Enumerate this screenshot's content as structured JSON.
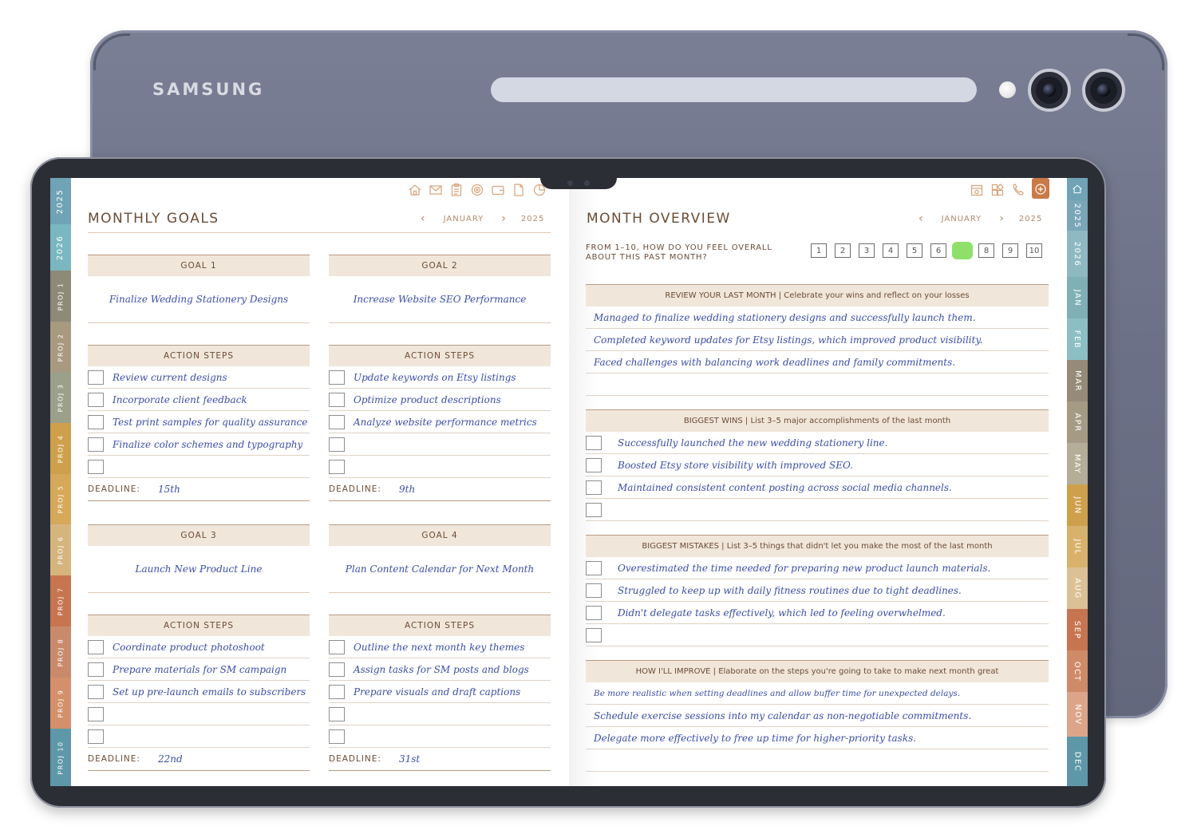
{
  "device": {
    "brand": "SAMSUNG"
  },
  "left_tabs": [
    {
      "label": "2025",
      "color": "#6fa3b5"
    },
    {
      "label": "2026",
      "color": "#7ab7c0"
    },
    {
      "label": "PROJ 1",
      "color": "#8d8a78"
    },
    {
      "label": "PROJ 2",
      "color": "#a79a7f"
    },
    {
      "label": "PROJ 3",
      "color": "#9aa08a"
    },
    {
      "label": "PROJ 4",
      "color": "#cfa04c"
    },
    {
      "label": "PROJ 5",
      "color": "#d5a85a"
    },
    {
      "label": "PROJ 6",
      "color": "#d5b47e"
    },
    {
      "label": "PROJ 7",
      "color": "#c77550"
    },
    {
      "label": "PROJ 8",
      "color": "#c98a6c"
    },
    {
      "label": "PROJ 9",
      "color": "#d3906a"
    },
    {
      "label": "PROJ 10",
      "color": "#5e98a8"
    }
  ],
  "right_tabs": [
    {
      "label": "home",
      "color": "#6fa3b5"
    },
    {
      "label": "2025",
      "color": "#7aa6b8"
    },
    {
      "label": "2026",
      "color": "#8fb9c2"
    },
    {
      "label": "JAN",
      "color": "#7fb0b6"
    },
    {
      "label": "FEB",
      "color": "#8cbfc3"
    },
    {
      "label": "MAR",
      "color": "#958b78"
    },
    {
      "label": "APR",
      "color": "#a59b85"
    },
    {
      "label": "MAY",
      "color": "#b4ad98"
    },
    {
      "label": "JUN",
      "color": "#cfa04c"
    },
    {
      "label": "JUL",
      "color": "#d8b26c"
    },
    {
      "label": "AUG",
      "color": "#dcc196"
    },
    {
      "label": "SEP",
      "color": "#c77550"
    },
    {
      "label": "OCT",
      "color": "#cf8b68"
    },
    {
      "label": "NOV",
      "color": "#dca58a"
    },
    {
      "label": "DEC",
      "color": "#5e98a8"
    }
  ],
  "left_page": {
    "title": "MONTHLY GOALS",
    "month": "JANUARY",
    "year": "2025",
    "deadline_label": "DEADLINE:",
    "action_steps_label": "ACTION STEPS",
    "goals": [
      {
        "header": "GOAL 1",
        "text": "Finalize Wedding Stationery Designs",
        "steps": [
          "Review current designs",
          "Incorporate client feedback",
          "Test print samples for quality assurance",
          "Finalize color schemes and typography",
          ""
        ],
        "deadline": "15th"
      },
      {
        "header": "GOAL 2",
        "text": "Increase Website SEO Performance",
        "steps": [
          "Update keywords on Etsy listings",
          "Optimize product descriptions",
          "Analyze website performance metrics",
          "",
          ""
        ],
        "deadline": "9th"
      },
      {
        "header": "GOAL 3",
        "text": "Launch New Product Line",
        "steps": [
          "Coordinate product photoshoot",
          "Prepare materials for SM campaign",
          "Set up pre-launch emails to subscribers",
          "",
          ""
        ],
        "deadline": "22nd"
      },
      {
        "header": "GOAL 4",
        "text": "Plan Content Calendar for Next Month",
        "steps": [
          "Outline the next month key themes",
          "Assign tasks for SM posts and blogs",
          "Prepare visuals and draft captions",
          "",
          ""
        ],
        "deadline": "31st"
      }
    ]
  },
  "right_page": {
    "title": "MONTH OVERVIEW",
    "month": "JANUARY",
    "year": "2025",
    "rating_question": "FROM 1–10, HOW DO YOU FEEL OVERALL ABOUT THIS PAST MONTH?",
    "rating_options": [
      "1",
      "2",
      "3",
      "4",
      "5",
      "6",
      "7",
      "8",
      "9",
      "10"
    ],
    "rating_selected": 7,
    "review": {
      "header": "REVIEW YOUR LAST MONTH | Celebrate your wins and reflect on your losses",
      "lines": [
        "Managed to finalize wedding stationery designs and successfully launch them.",
        "Completed keyword updates for Etsy listings, which improved product visibility.",
        "Faced challenges with balancing work deadlines and family commitments.",
        ""
      ]
    },
    "wins": {
      "header": "BIGGEST WINS | List 3–5 major accomplishments of the last month",
      "items": [
        "Successfully launched the new wedding stationery line.",
        "Boosted Etsy store visibility with improved SEO.",
        "Maintained consistent content posting across social media channels.",
        ""
      ]
    },
    "mistakes": {
      "header": "BIGGEST MISTAKES | List 3–5 things that didn't let you make the most of the last month",
      "items": [
        "Overestimated the time needed for preparing new product launch materials.",
        "Struggled to keep up with daily fitness routines due to tight deadlines.",
        "Didn't delegate tasks effectively, which led to feeling overwhelmed.",
        ""
      ]
    },
    "improve": {
      "header": "HOW I'LL IMPROVE | Elaborate on the steps you're going to take to make next month great",
      "lines": [
        "Be more realistic when setting deadlines and allow buffer time for unexpected delays.",
        "Schedule exercise sessions into my calendar as non-negotiable commitments.",
        "Delegate more effectively to free up time for higher-priority tasks.",
        ""
      ]
    }
  }
}
